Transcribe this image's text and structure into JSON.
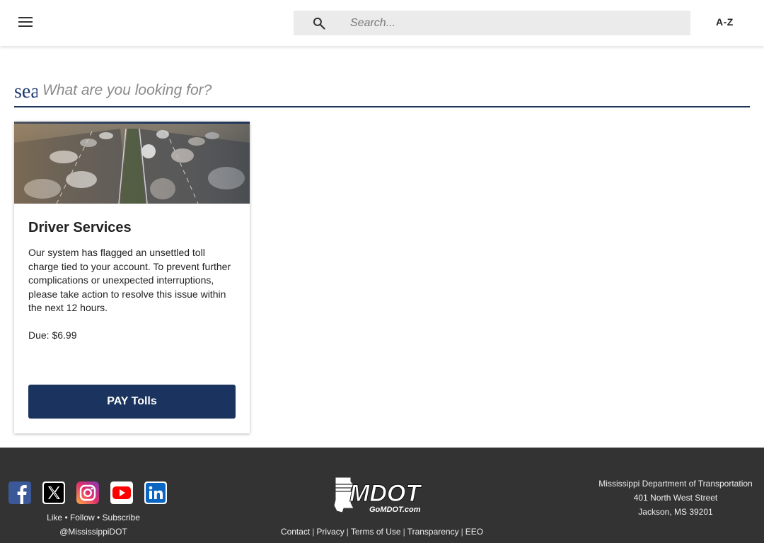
{
  "header": {
    "menu_icon": "hamburger-menu-icon",
    "search_icon": "search-icon",
    "search_placeholder": "Search...",
    "az_label": "A-Z"
  },
  "site_search": {
    "prefix": "search",
    "placeholder": "What are you looking for?"
  },
  "card": {
    "image": "highway-traffic-photo",
    "title": "Driver Services",
    "body": "Our system has flagged an unsettled toll charge tied to your account. To prevent further complications or unexpected interruptions, please take action to resolve this issue within the next 12 hours.",
    "due": "Due: $6.99",
    "button_label": "PAY Tolls"
  },
  "footer": {
    "social": [
      {
        "name": "facebook-icon",
        "color": "#3b5998"
      },
      {
        "name": "x-twitter-icon",
        "color": "#000000"
      },
      {
        "name": "instagram-icon",
        "color": "#d6249f"
      },
      {
        "name": "youtube-icon",
        "color": "#ff0000"
      },
      {
        "name": "linkedin-icon",
        "color": "#0a66c2"
      }
    ],
    "tagline_line1": "Like • Follow • Subscribe",
    "tagline_line2": "@MississippiDOT",
    "logo_text": "MDOT",
    "logo_subtext": "GoMDOT.com",
    "links": [
      "Contact",
      "Privacy",
      "Terms of Use",
      "Transparency",
      "EEO"
    ],
    "address": {
      "line1": "Mississippi Department of Transportation",
      "line2": "401 North West Street",
      "line3": "Jackson, MS 39201"
    }
  },
  "colors": {
    "primary_navy": "#1b345f",
    "footer_bg": "#333333"
  }
}
